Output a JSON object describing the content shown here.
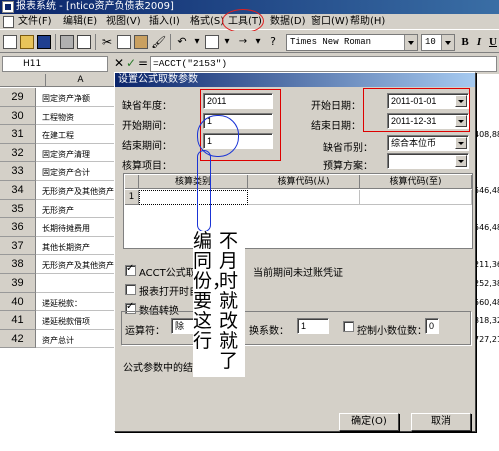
{
  "window": {
    "title": "报表系统 - [ntico资产负债表2009]"
  },
  "menu": [
    {
      "label": "文件(F)"
    },
    {
      "label": "编辑(E)"
    },
    {
      "label": "视图(V)"
    },
    {
      "label": "插入(I)"
    },
    {
      "label": "格式(S)"
    },
    {
      "label": "工具(T)"
    },
    {
      "label": "数据(D)"
    },
    {
      "label": "窗口(W)"
    },
    {
      "label": "帮助(H)"
    }
  ],
  "toolbar": {
    "font_name": "Times New Roman",
    "font_size": "10",
    "bold": "B",
    "italic": "I",
    "underline": "U"
  },
  "formula_bar": {
    "cell_ref": "H11",
    "formula": "=ACCT(\"2153\")"
  },
  "sheet": {
    "column_a": "A",
    "rows": [
      {
        "num": "29",
        "text": "固定资产净额",
        "right": ""
      },
      {
        "num": "30",
        "text": "工程物资",
        "right": ""
      },
      {
        "num": "31",
        "text": "在建工程",
        "right": "408,88"
      },
      {
        "num": "32",
        "text": "固定资产清理",
        "right": ""
      },
      {
        "num": "33",
        "text": "固定资产合计",
        "right": ""
      },
      {
        "num": "34",
        "text": "无形资产及其他资产：",
        "right": "546,48"
      },
      {
        "num": "35",
        "text": "无形资产",
        "right": ""
      },
      {
        "num": "36",
        "text": "长期待摊费用",
        "right": "546,48"
      },
      {
        "num": "37",
        "text": "其他长期资产",
        "right": ""
      },
      {
        "num": "38",
        "text": "无形资产及其他资产",
        "right": "211,36"
      },
      {
        "num": "39",
        "text": "",
        "right": "252,38"
      },
      {
        "num": "40",
        "text": "递延税款：",
        "right": "560,48"
      },
      {
        "num": "41",
        "text": "递延税款借项",
        "right": "318,32"
      },
      {
        "num": "42",
        "text": "资产总计",
        "right": "727,21"
      }
    ]
  },
  "dialog": {
    "title": "设置公式取数参数",
    "year_label": "缺省年度：",
    "year_value": "2011",
    "start_period_label": "开始期间：",
    "start_period_value": "1",
    "end_period_label": "结束期间：",
    "end_period_value": "1",
    "start_date_label": "开始日期：",
    "start_date_value": "2011-01-01",
    "end_date_label": "结束日期：",
    "end_date_value": "2011-12-31",
    "currency_label": "缺省币别：",
    "currency_value": "综合本位币",
    "budget_label": "预算方案：",
    "budget_value": "",
    "item_label": "核算项目：",
    "grid_headers": [
      "核算类别",
      "核算代码(从)",
      "核算代码(至)"
    ],
    "grid_row_num": "1",
    "chk_acct_label": "ACCT公式取数",
    "chk_acct_tail": "当前期间未过账凭证",
    "chk_open_label": "报表打开时自",
    "chk_convert_label": "数值转换",
    "operator_label": "运算符：",
    "operator_value": "除",
    "coef_label": "换系数：",
    "coef_value": "1",
    "decimal_label": "控制小数位数：",
    "decimal_value": "0",
    "footer_text": "公式参数中的结束",
    "ok_label": "确定(O)",
    "cancel_label": "取消"
  },
  "annotation": {
    "col1": "编同份，要这行",
    "col2": "不月时就改就了"
  }
}
